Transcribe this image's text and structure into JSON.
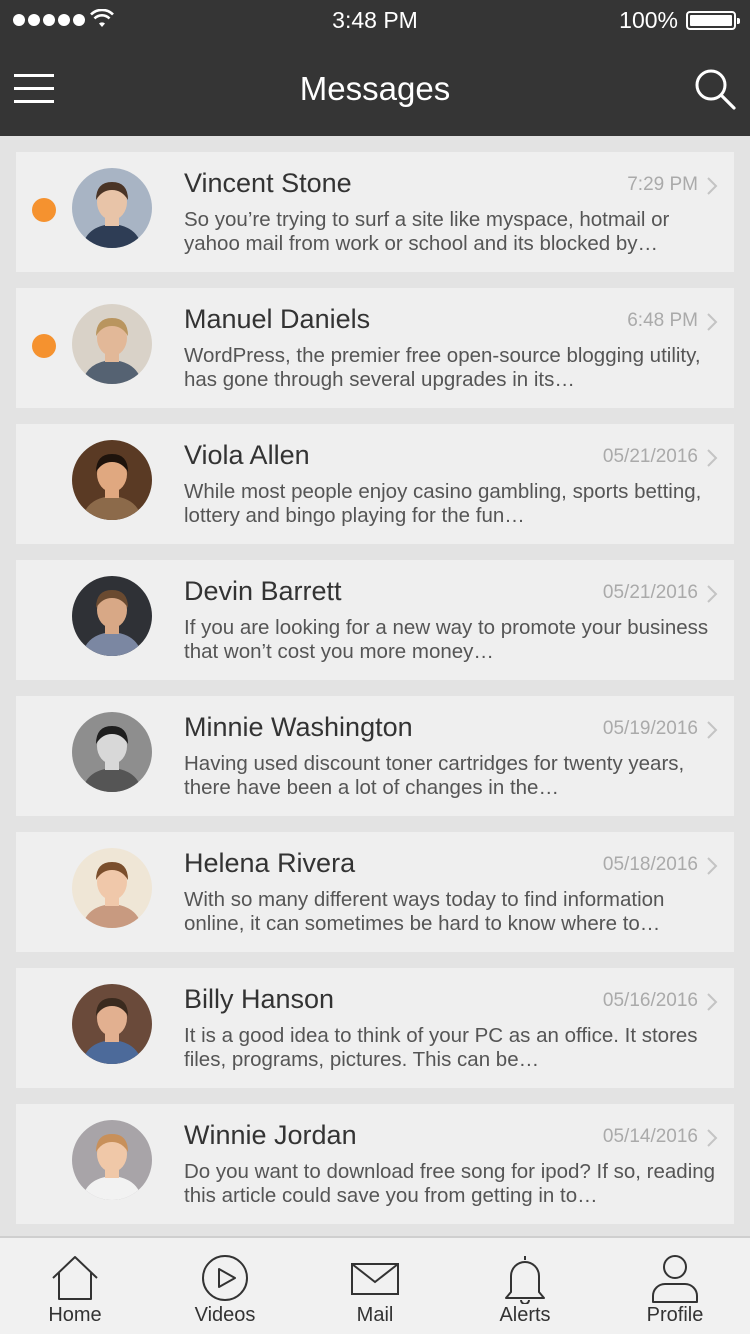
{
  "status_bar": {
    "time": "3:48 PM",
    "battery": "100%"
  },
  "header": {
    "title": "Messages"
  },
  "messages": [
    {
      "name": "Vincent Stone",
      "date": "7:29 PM",
      "unread": true,
      "preview": "So you’re trying to surf a site like myspace, hotmail or yahoo mail from work or school and its blocked by…",
      "avatar": {
        "bg": "#a8b4c4",
        "skin": "#e8c4a8",
        "hair": "#4a3426",
        "shirt": "#2e3d55"
      }
    },
    {
      "name": "Manuel Daniels",
      "date": "6:48 PM",
      "unread": true,
      "preview": "WordPress, the premier free open-source blogging utility, has gone through several upgrades in its…",
      "avatar": {
        "bg": "#d9d2c8",
        "skin": "#e2b898",
        "hair": "#b9955f",
        "shirt": "#556272"
      }
    },
    {
      "name": "Viola Allen",
      "date": "05/21/2016",
      "unread": false,
      "preview": "While most people enjoy casino gambling, sports betting, lottery and bingo playing for the fun…",
      "avatar": {
        "bg": "#5a3a24",
        "skin": "#e0a880",
        "hair": "#1e130c",
        "shirt": "#8c6a4a"
      }
    },
    {
      "name": "Devin Barrett",
      "date": "05/21/2016",
      "unread": false,
      "preview": "If you are looking for a new way to promote your business that won’t cost you more money…",
      "avatar": {
        "bg": "#2f3136",
        "skin": "#d8a886",
        "hair": "#6a4a30",
        "shirt": "#7b87a2"
      }
    },
    {
      "name": "Minnie Washington",
      "date": "05/19/2016",
      "unread": false,
      "preview": "Having used discount toner cartridges for twenty years, there have been a lot of changes in the…",
      "avatar": {
        "bg": "#8e8e8e",
        "skin": "#d8d8d8",
        "hair": "#1e1e1e",
        "shirt": "#555555"
      }
    },
    {
      "name": "Helena Rivera",
      "date": "05/18/2016",
      "unread": false,
      "preview": "With so many different ways today to find information online, it can sometimes be hard to know where to…",
      "avatar": {
        "bg": "#efe6d6",
        "skin": "#f0c8aa",
        "hair": "#7a4e2c",
        "shirt": "#c89a80"
      }
    },
    {
      "name": "Billy Hanson",
      "date": "05/16/2016",
      "unread": false,
      "preview": "It is a good idea to think of your PC as an office. It stores files, programs, pictures. This can be…",
      "avatar": {
        "bg": "#6a4a3a",
        "skin": "#e2b090",
        "hair": "#3a2a1e",
        "shirt": "#4c6a9a"
      }
    },
    {
      "name": "Winnie Jordan",
      "date": "05/14/2016",
      "unread": false,
      "preview": "Do you want to download free song for ipod? If so, reading this article could save you from getting in to…",
      "avatar": {
        "bg": "#a8a4a8",
        "skin": "#f0c8a8",
        "hair": "#c8905a",
        "shirt": "#f2f2f2"
      }
    }
  ],
  "tabs": [
    {
      "id": "home",
      "label": "Home",
      "icon": "home-icon"
    },
    {
      "id": "videos",
      "label": "Videos",
      "icon": "play-circle-icon"
    },
    {
      "id": "mail",
      "label": "Mail",
      "icon": "mail-icon"
    },
    {
      "id": "alerts",
      "label": "Alerts",
      "icon": "bell-icon"
    },
    {
      "id": "profile",
      "label": "Profile",
      "icon": "user-icon"
    }
  ],
  "colors": {
    "header_bg": "#353535",
    "unread_dot": "#f5922f",
    "card_bg": "#efefef",
    "page_bg": "#e3e3e3",
    "date_text": "#aaaaaa"
  }
}
